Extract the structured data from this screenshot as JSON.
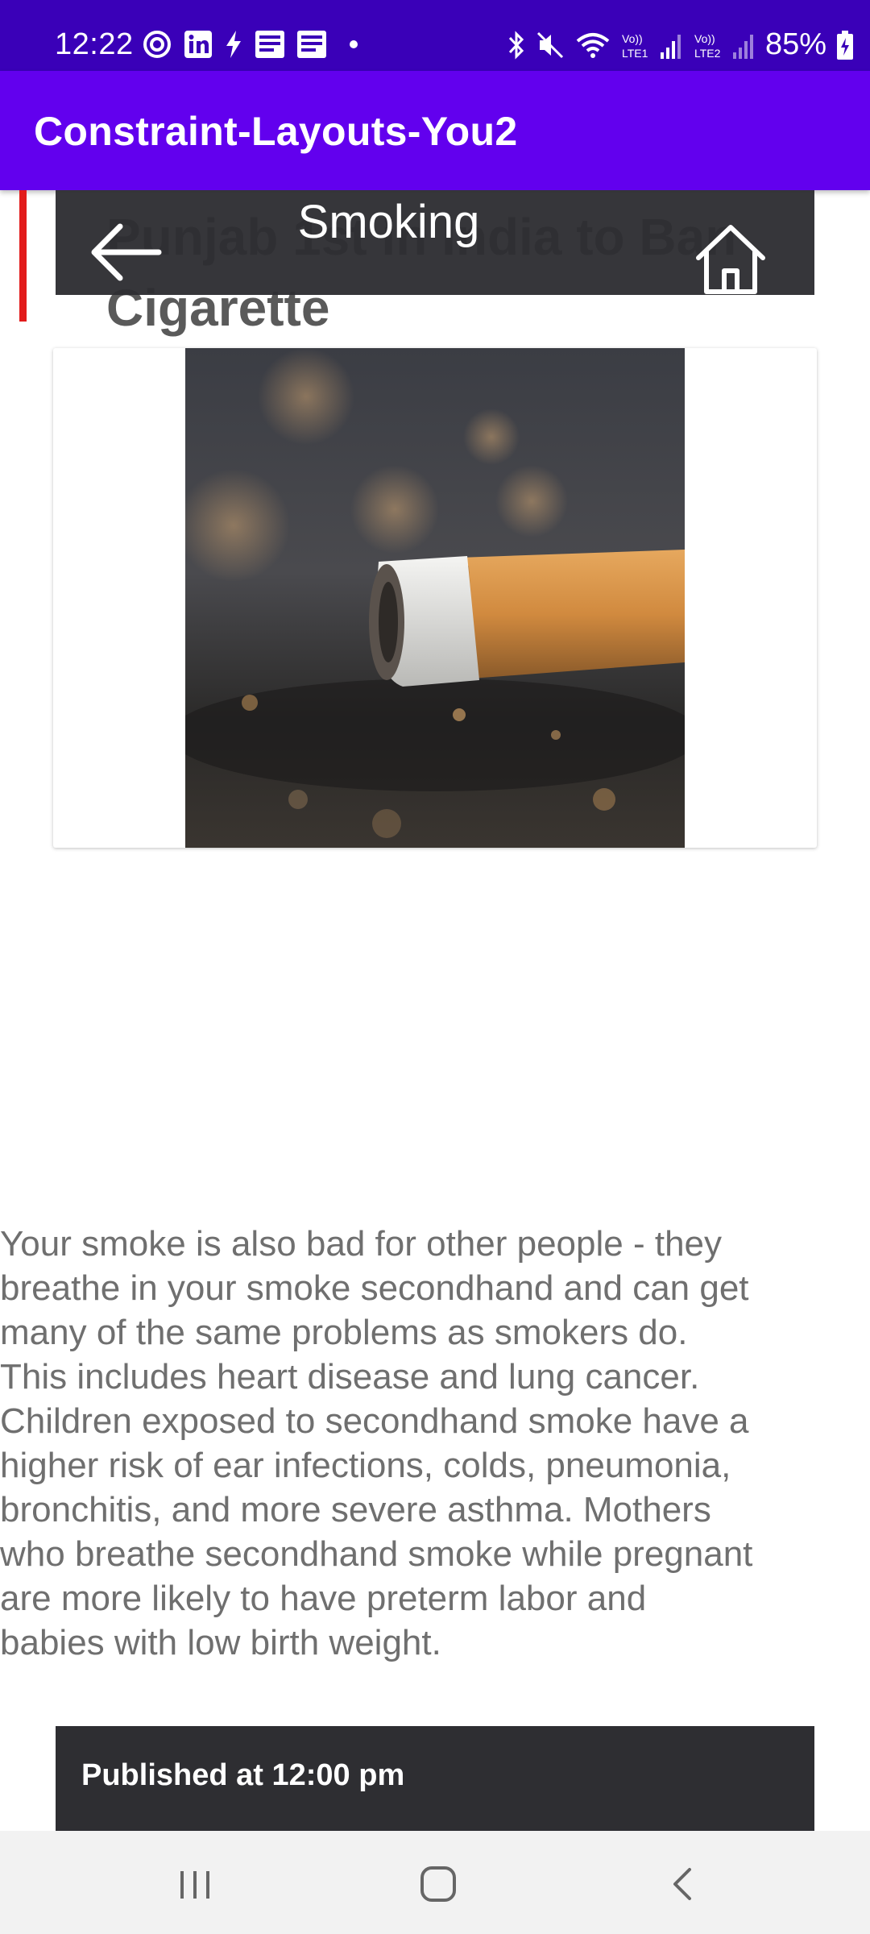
{
  "status_bar": {
    "time": "12:22",
    "battery": "85%",
    "left_icons": [
      "signal-swirl-icon",
      "linkedin-icon",
      "bolt-icon",
      "news-icon",
      "news-icon",
      "dot-icon"
    ],
    "right_icons": [
      "bluetooth-icon",
      "mute-icon",
      "wifi-icon",
      "lte1-signal-icon",
      "lte2-signal-icon",
      "battery-charging-icon"
    ]
  },
  "app_bar": {
    "title": "Constraint-Layouts-You2"
  },
  "article": {
    "headline": "Punjab 1st in India to Ban Cigarette",
    "toolbar_title": "Smoking",
    "back_icon": "arrow-left-icon",
    "home_icon": "home-icon",
    "image_description_icon": "cigarette-photo",
    "body": "Your smoke is also bad for other people - they breathe in your smoke secondhand and can get many of the same problems as smokers do. This includes heart disease and lung cancer. Children exposed to secondhand smoke have a higher risk of ear infections, colds, pneumonia, bronchitis, and more severe asthma. Mothers who breathe secondhand smoke while pregnant are more likely to have preterm labor and babies with low birth weight.",
    "published": "Published at 12:00 pm"
  },
  "colors": {
    "status_bar": "#3a00b8",
    "app_bar": "#6200ee",
    "accent_line": "#e21b1b",
    "toolbar": "#2e2e32"
  },
  "nav_bar": {
    "icons": [
      "recents-icon",
      "home-circle-icon",
      "back-chevron-icon"
    ]
  }
}
